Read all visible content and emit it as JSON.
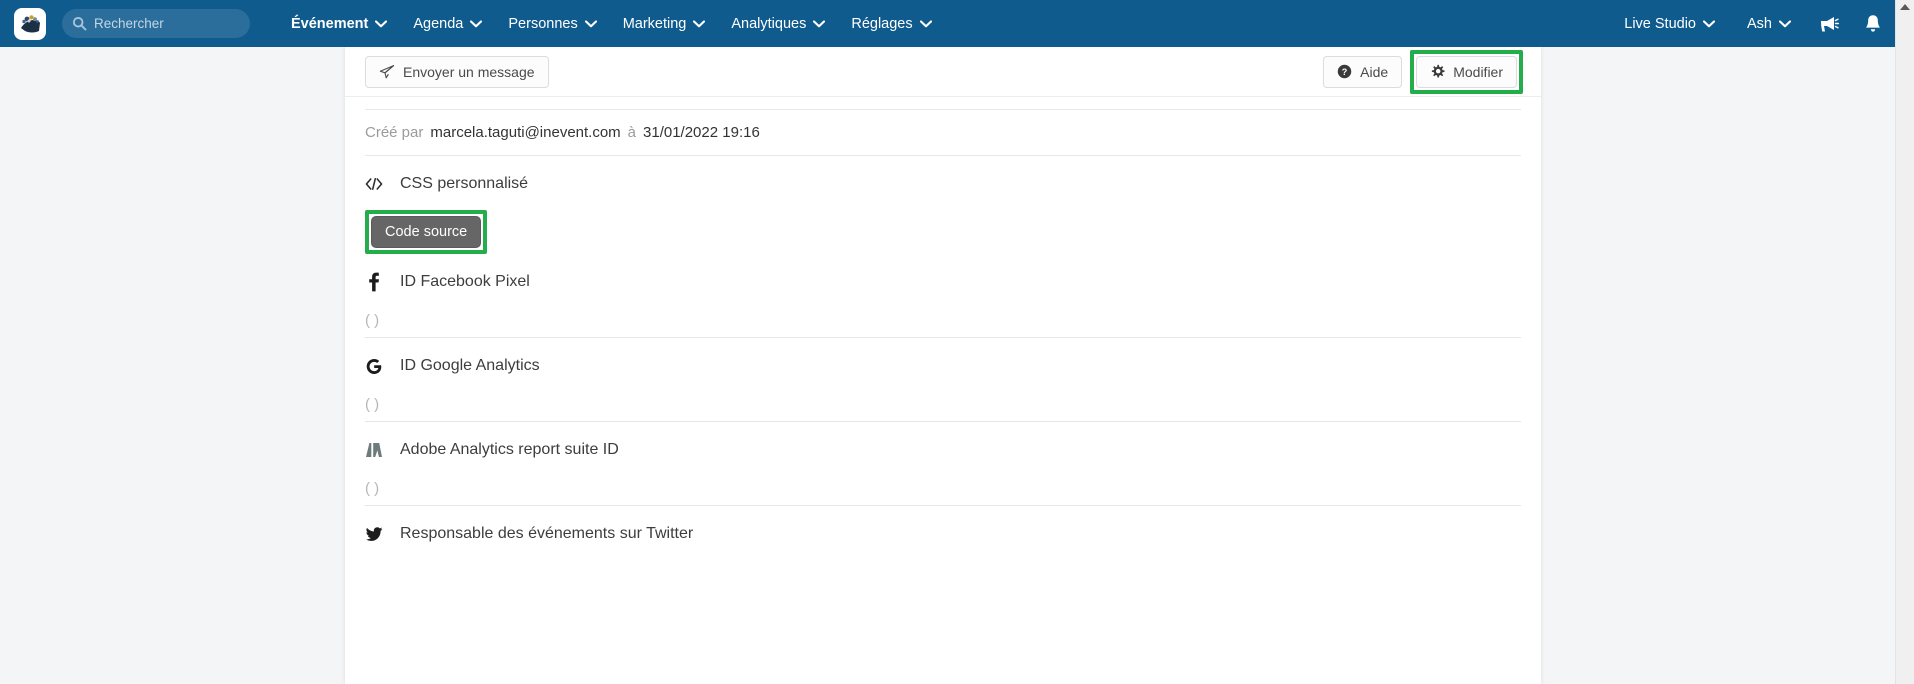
{
  "topnav": {
    "logo_name": "inevent-logo",
    "search": {
      "placeholder": "Rechercher",
      "value": ""
    },
    "items": [
      {
        "label": "Événement",
        "active": true
      },
      {
        "label": "Agenda",
        "active": false
      },
      {
        "label": "Personnes",
        "active": false
      },
      {
        "label": "Marketing",
        "active": false
      },
      {
        "label": "Analytiques",
        "active": false
      },
      {
        "label": "Réglages",
        "active": false
      }
    ],
    "right_items": [
      {
        "label": "Live Studio"
      },
      {
        "label": "Ash"
      }
    ],
    "icons": [
      {
        "name": "megaphone-icon"
      },
      {
        "name": "bell-icon"
      }
    ],
    "bg_color": "#0f5b8e"
  },
  "toolbar": {
    "send_message_label": "Envoyer un message",
    "help_label": "Aide",
    "edit_label": "Modifier",
    "highlight_color": "#25ac4b"
  },
  "meta": {
    "created_by_label": "Créé par",
    "created_by_email": "marcela.taguti@inevent.com",
    "at_label": "à",
    "created_at": "31/01/2022 19:16"
  },
  "fields": [
    {
      "icon": "code-icon",
      "label": "CSS personnalisé",
      "type": "source-button",
      "button_label": "Code source",
      "highlighted": true
    },
    {
      "icon": "facebook-icon",
      "label": "ID Facebook Pixel",
      "type": "text",
      "value": "( )"
    },
    {
      "icon": "google-icon",
      "label": "ID Google Analytics",
      "type": "text",
      "value": "( )"
    },
    {
      "icon": "adobe-icon",
      "label": "Adobe Analytics report suite ID",
      "type": "text",
      "value": "( )"
    },
    {
      "icon": "twitter-icon",
      "label": "Responsable des événements sur Twitter",
      "type": "text",
      "value": ""
    }
  ],
  "scrollbar": {
    "arrow_up": "scroll-up-arrow"
  }
}
